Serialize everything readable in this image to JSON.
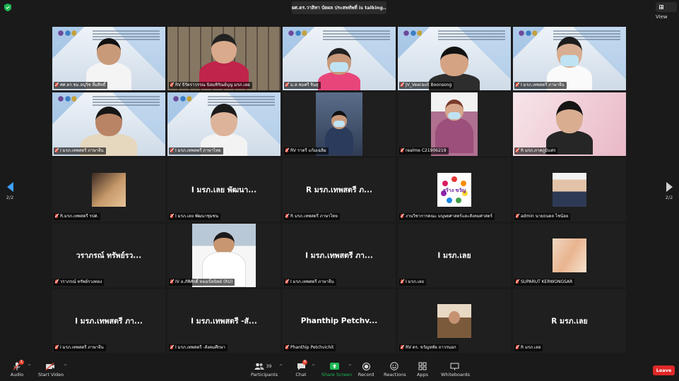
{
  "header": {
    "talking": "ผศ.ดร.วาสิทา บัตผล ประสพทัพที่ is talking...",
    "view_label": "View"
  },
  "pager": {
    "left": "2/2",
    "right": "2/2"
  },
  "tiles": [
    {
      "kind": "video",
      "name": "ศศ.ดร.ชม.อนุวิช ลิ้มสิทธิ์"
    },
    {
      "kind": "room",
      "name": "RV ธิรัตราวรรณ นิลมหิรัณย์บุญ มรภ.เลย"
    },
    {
      "kind": "video",
      "name": "ม.ส.ชมศรี จิ๋นสุ"
    },
    {
      "kind": "video",
      "name": "JV_Veeravit Boonsong"
    },
    {
      "kind": "video",
      "name": "I มรภ.เทพสตรี ภาษาจีน"
    },
    {
      "kind": "video",
      "name": "I มรภ.เทพสตรี ภาษาจีน"
    },
    {
      "kind": "video",
      "name": "I มรภ.เทพสตรี ภาษาไทย"
    },
    {
      "kind": "center",
      "name": "RV ราตรี แก้มเฉลิม"
    },
    {
      "kind": "center",
      "name": "realme C21906219"
    },
    {
      "kind": "pink",
      "name": "R มรภ.ภาคภูมิแต่ร"
    },
    {
      "kind": "avatar",
      "name": "R.มรภ.เทพสตรี รปศ.",
      "display": ""
    },
    {
      "kind": "text",
      "name": "I มรภ.เลย พัฒนาชุมชน",
      "display": "I มรภ.เลย พัฒนา..."
    },
    {
      "kind": "text",
      "name": "R มรภ.เทพสตรี ภาษาไทย",
      "display": "R มรภ.เทพสตรี ภ..."
    },
    {
      "kind": "avatar",
      "name": "งานวิชาการคณะ มนุษยศาสตร์และสังคมศาสตร์",
      "display": "สร้าง ขวัญ"
    },
    {
      "kind": "avatar",
      "name": "admin นายธนดล ไชน้อย",
      "display": ""
    },
    {
      "kind": "text",
      "name": "วราภรณ์ ทรัพย์รวงทอง",
      "display": "วราภรณ์ ทรัพย์รว..."
    },
    {
      "kind": "avatar",
      "name": "IV อ.ภัทิศักดิ์ ทองเบิ้ลนิพย์ (RU)",
      "display": ""
    },
    {
      "kind": "text",
      "name": "I มรภ.เทพสตรี ภาษาจีน",
      "display": "I มรภ.เทพสตรี ภา..."
    },
    {
      "kind": "text",
      "name": "I มรภ.เลย",
      "display": "I มรภ.เลย"
    },
    {
      "kind": "avatar",
      "name": "SUPARUT KERWONGSAR",
      "display": ""
    },
    {
      "kind": "text",
      "name": "I มรภ.เทพสตรี ภาษาจีน",
      "display": "I มรภ.เทพสตรี ภา..."
    },
    {
      "kind": "text",
      "name": "I มรภ.เทพสตรี -สังคมศึกษา",
      "display": "I มรภ.เทพสตรี -สั..."
    },
    {
      "kind": "text",
      "name": "Phanthip Petchvichit",
      "display": "Phanthip  Petchv..."
    },
    {
      "kind": "avatar",
      "name": "RV ดร. ขวัญหทัย ถาวรนอก",
      "display": ""
    },
    {
      "kind": "text",
      "name": "R มรภ.เลย",
      "display": "R มรภ.เลย"
    }
  ],
  "toolbar": {
    "audio": "Audio",
    "audio_badge": "1",
    "video": "Start Video",
    "participants": "Participants",
    "participants_count": "39",
    "chat": "Chat",
    "chat_badge": "8",
    "share": "Share Screen",
    "record": "Record",
    "reactions": "Reactions",
    "apps": "Apps",
    "whiteboards": "Whiteboards",
    "leave": "Leave"
  },
  "colors": {
    "leave": "#e02828",
    "share": "#1db954",
    "pager_active": "#3fa0ff"
  }
}
